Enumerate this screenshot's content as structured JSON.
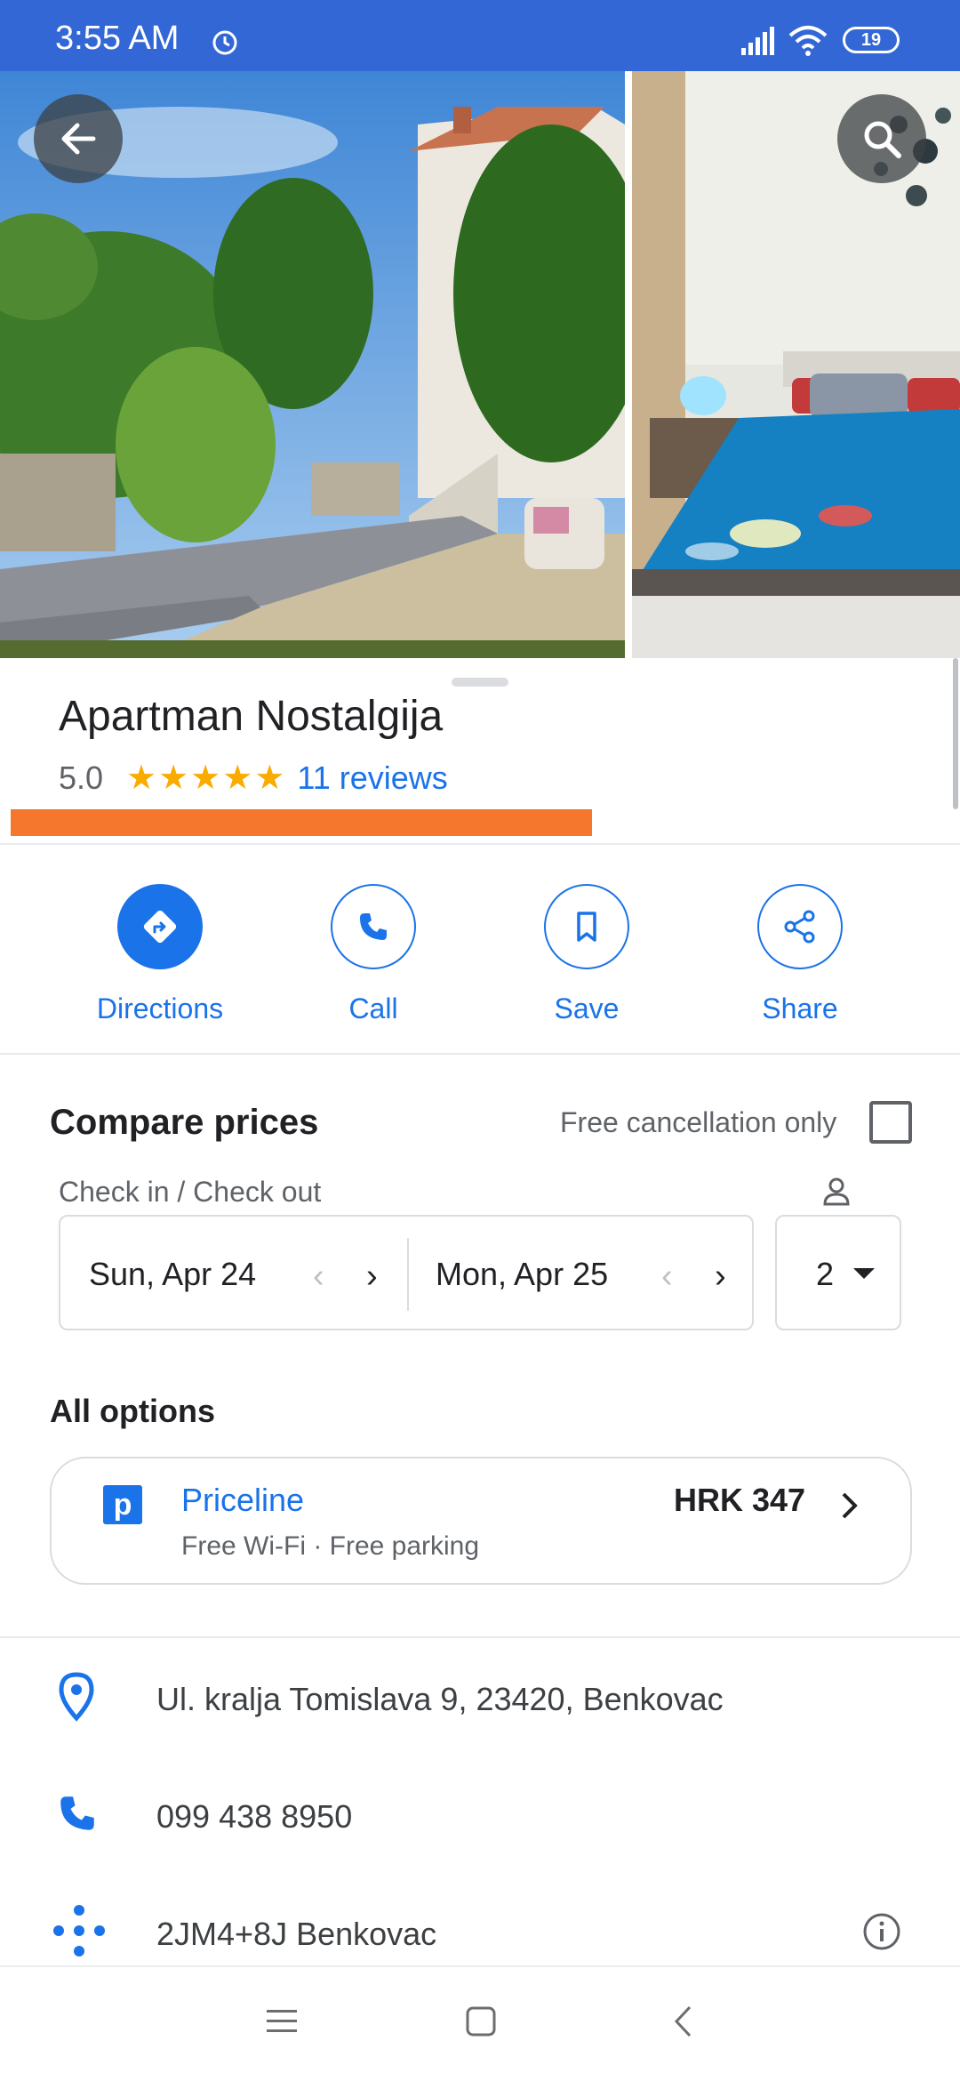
{
  "status_bar": {
    "time": "3:55 AM",
    "battery": "19"
  },
  "place": {
    "name": "Apartman Nostalgija",
    "rating": "5.0",
    "stars": "★★★★★",
    "reviews": "11 reviews"
  },
  "actions": [
    {
      "label": "Directions"
    },
    {
      "label": "Call"
    },
    {
      "label": "Save"
    },
    {
      "label": "Share"
    }
  ],
  "compare": {
    "title": "Compare prices",
    "free_cancel_label": "Free cancellation only",
    "free_cancel_checked": false,
    "dates_label": "Check in / Check out",
    "check_in": "Sun, Apr 24",
    "check_out": "Mon, Apr 25",
    "guests": "2"
  },
  "options": {
    "title": "All options",
    "items": [
      {
        "logo": "p",
        "provider": "Priceline",
        "price": "HRK 347",
        "amenities": "Free Wi-Fi · Free parking"
      }
    ]
  },
  "info": {
    "address": "Ul. kralja Tomislava 9, 23420, Benkovac",
    "phone": "099 438 8950",
    "plus_code": "2JM4+8J Benkovac"
  },
  "icons": [
    "back-arrow-icon",
    "search-icon",
    "directions-icon",
    "phone-icon",
    "bookmark-icon",
    "share-icon",
    "person-icon",
    "location-pin-icon",
    "plus-code-icon",
    "info-icon",
    "menu-icon",
    "home-icon",
    "back-icon"
  ],
  "colors": {
    "status_bar": "#3367d6",
    "accent": "#1a73e8",
    "star": "#f9ab00",
    "highlight": "#f5772d"
  }
}
